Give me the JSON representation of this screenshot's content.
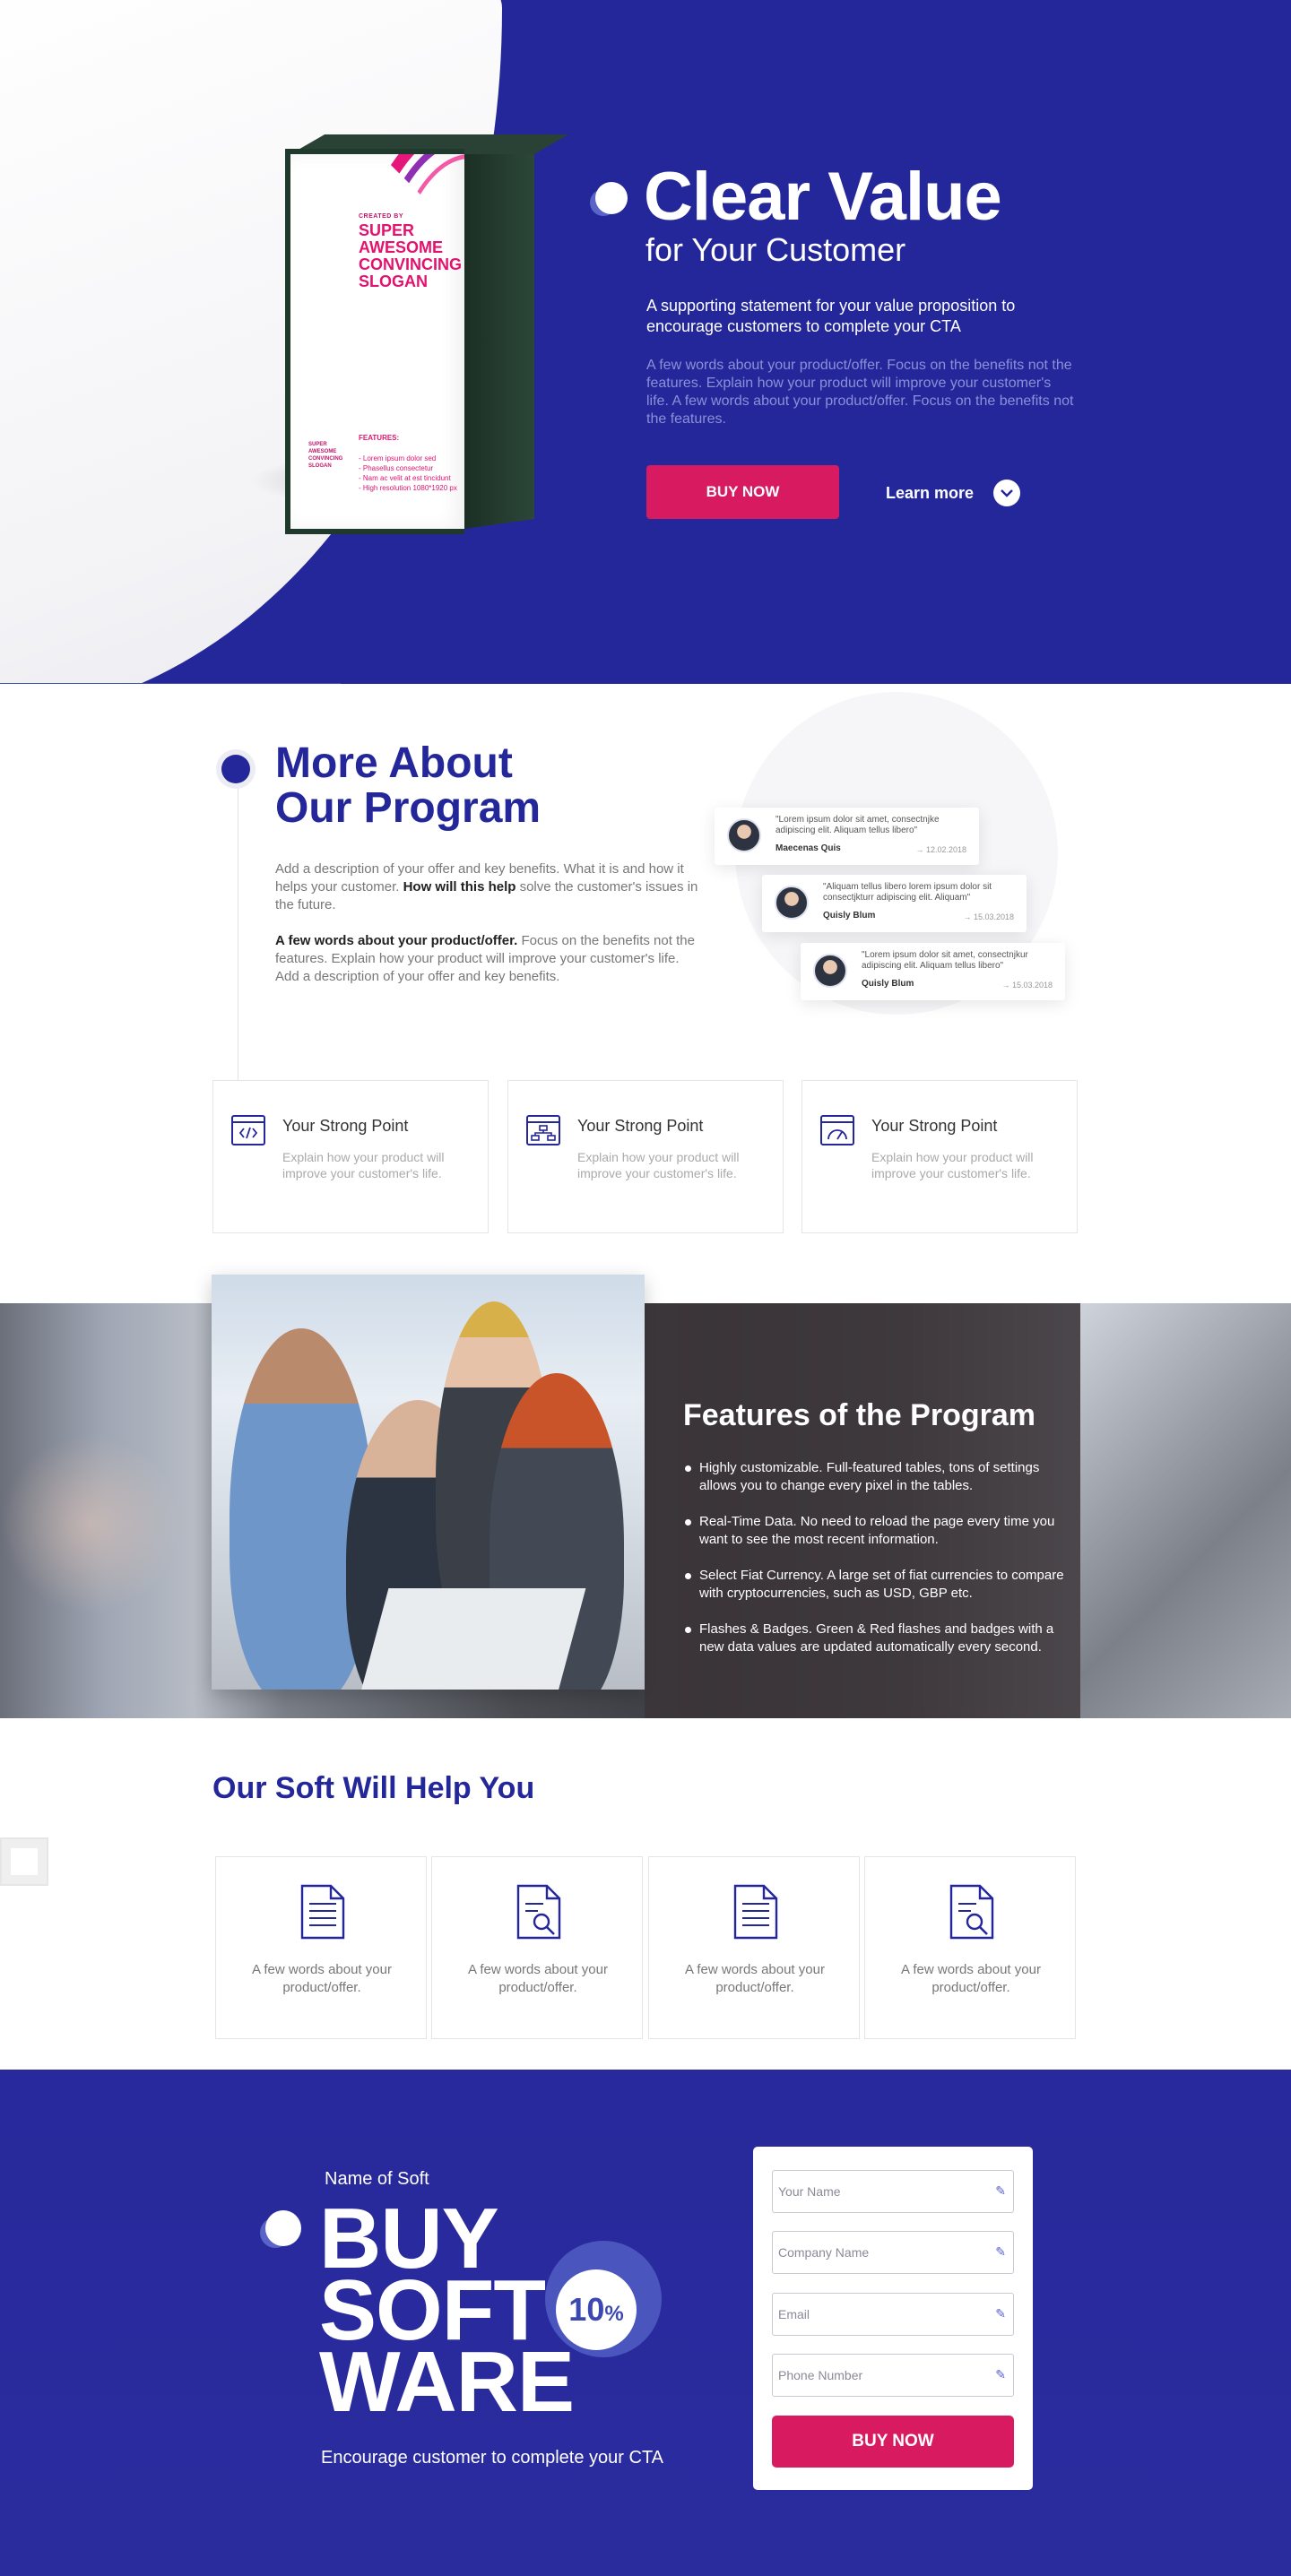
{
  "hero": {
    "title": "Clear Value",
    "subtitle": "for Your Customer",
    "support": "A supporting statement for your value proposition to encourage customers to complete your CTA",
    "description": "A few words about your product/offer. Focus on the benefits not the features. Explain how your product will improve your customer's life. A few words about your product/offer. Focus on the benefits not the features.",
    "buy_label": "BUY NOW",
    "learn_label": "Learn more",
    "box": {
      "created_by": "CREATED BY",
      "slogan": "SUPER AWESOME CONVINCING SLOGAN",
      "features_label": "FEATURES:",
      "features": [
        "- Lorem ipsum dolor sed",
        "- Phasellus consectetur",
        "- Nam ac velit at est tincidunt",
        "- High resolution 1080*1920 px"
      ],
      "spine": "SUPER AWESOME CONVINCING SLOGAN"
    }
  },
  "about": {
    "title_light": "More About",
    "title_bold": "Our Program",
    "p1_pre": "Add a description of your offer and key benefits. What it is and how it helps your customer. ",
    "p1_bold": "How will this help",
    "p1_post": " solve the customer's issues in the future.",
    "p2_bold": "A few words about your product/offer.",
    "p2_post": " Focus on the benefits not the features. Explain how your product will improve your customer's life. Add a description of your offer and key benefits.",
    "reviews": [
      {
        "quote": "\"Lorem ipsum dolor sit amet, consectnjke adipiscing elit. Aliquam tellus libero\"",
        "name": "Maecenas Quis",
        "date": "→ 12.02.2018"
      },
      {
        "quote": "\"Aliquam tellus libero lorem ipsum dolor sit consectjkturr adipiscing elit. Aliquam\"",
        "name": "Quisly Blum",
        "date": "→ 15.03.2018"
      },
      {
        "quote": "\"Lorem ipsum dolor sit amet, consectnjkur adipiscing elit. Aliquam tellus libero\"",
        "name": "Quisly Blum",
        "date": "→ 15.03.2018"
      }
    ],
    "points": [
      {
        "icon": "code-window-icon",
        "title": "Your Strong Point",
        "desc": "Explain how your product will improve your customer's life."
      },
      {
        "icon": "sitemap-icon",
        "title": "Your Strong Point",
        "desc": "Explain how your product will improve your customer's life."
      },
      {
        "icon": "dashboard-gauge-icon",
        "title": "Your Strong Point",
        "desc": "Explain how your product will improve your customer's life."
      }
    ]
  },
  "features": {
    "title_light": "Features of ",
    "title_bold": "the Program",
    "items": [
      "Highly customizable. Full-featured tables, tons of settings allows you to change every pixel in the tables.",
      "Real-Time Data. No need to reload the page every time you want to see the most recent information.",
      "Select Fiat Currency. A large set of fiat currencies to compare with cryptocurrencies, such as USD, GBP etc.",
      "Flashes & Badges. Green & Red flashes and badges with a new data values are updated automatically every second."
    ]
  },
  "help": {
    "title_light": "Our Soft ",
    "title_bold": "Will Help You",
    "cards": [
      {
        "icon": "document-icon",
        "desc": "A few words about your product/offer."
      },
      {
        "icon": "document-search-icon",
        "desc": "A few words about your product/offer."
      },
      {
        "icon": "document-icon",
        "desc": "A few words about your product/offer."
      },
      {
        "icon": "document-search-icon",
        "desc": "A few words about your product/offer."
      }
    ]
  },
  "cta": {
    "name": "Name of Soft",
    "line1": "BUY",
    "line2": "SOFT",
    "line3": "WARE",
    "badge_value": "10",
    "badge_unit": "%",
    "encourage": "Encourage customer to complete your CTA",
    "form": {
      "name_placeholder": "Your Name",
      "company_placeholder": "Company Name",
      "email_placeholder": "Email",
      "phone_placeholder": "Phone Number",
      "submit_label": "BUY NOW"
    }
  },
  "colors": {
    "brand_blue": "#24279a",
    "accent_pink": "#d81b60"
  }
}
